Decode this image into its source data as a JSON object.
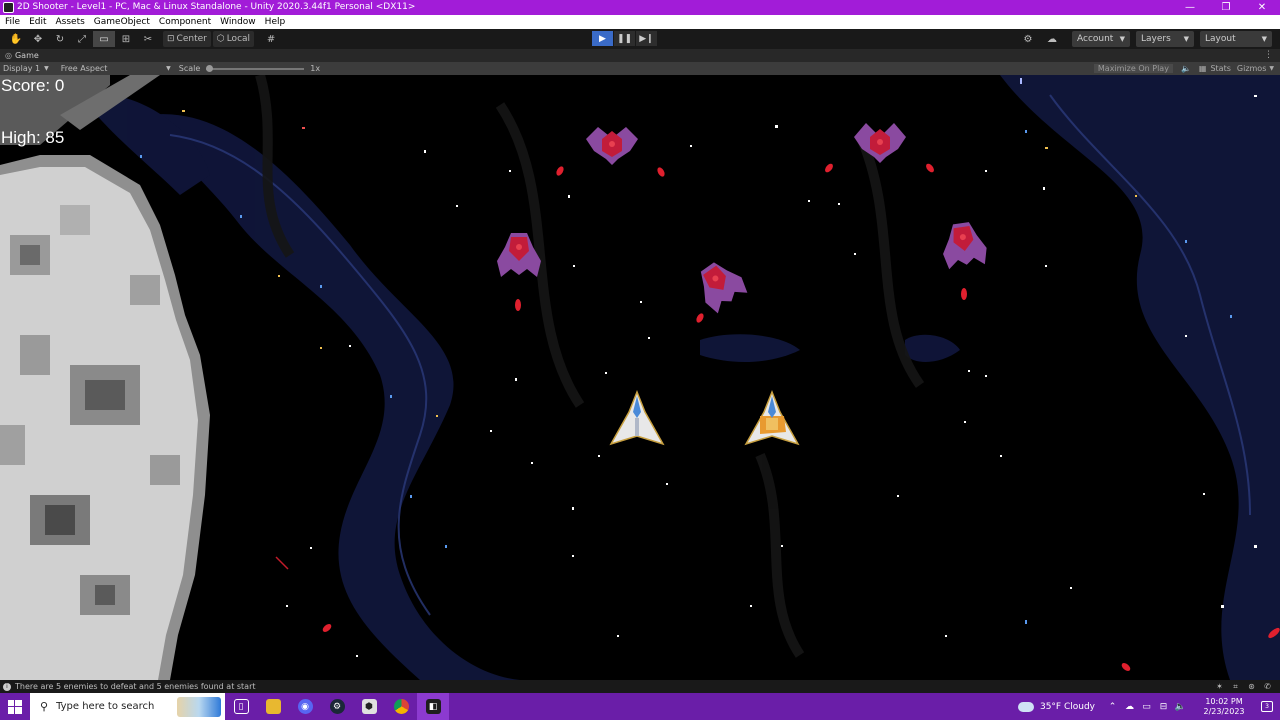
{
  "window": {
    "title": "2D Shooter - Level1 - PC, Mac & Linux Standalone - Unity 2020.3.44f1 Personal <DX11>",
    "minimize": "—",
    "maximize": "❐",
    "close": "✕"
  },
  "menu": {
    "items": [
      "File",
      "Edit",
      "Assets",
      "GameObject",
      "Component",
      "Window",
      "Help"
    ]
  },
  "toolbar": {
    "pivot_label": "Center",
    "space_label": "Local",
    "account_label": "Account",
    "layers_label": "Layers",
    "layout_label": "Layout"
  },
  "game_tab": {
    "label": "Game"
  },
  "game_bar": {
    "display": "Display 1",
    "aspect": "Free Aspect",
    "scale_label": "Scale",
    "scale_value": "1x",
    "maximize_on_play": "Maximize On Play",
    "stats": "Stats",
    "gizmos": "Gizmos"
  },
  "hud": {
    "score": "Score: 0",
    "high": "High: 85"
  },
  "status": {
    "message": "There are 5 enemies to defeat and 5 enemies found at start"
  },
  "taskbar": {
    "search_placeholder": "Type here to search",
    "weather": "35°F  Cloudy",
    "time": "10:02 PM",
    "date": "2/23/2023",
    "notification_count": "3"
  },
  "colors": {
    "title_bar": "#a21cd8",
    "taskbar": "#6a1ea8",
    "enemy_body": "#8a4aa0",
    "enemy_core": "#c21c3a",
    "bullet": "#e0202e",
    "nebula": "#141a3a"
  }
}
